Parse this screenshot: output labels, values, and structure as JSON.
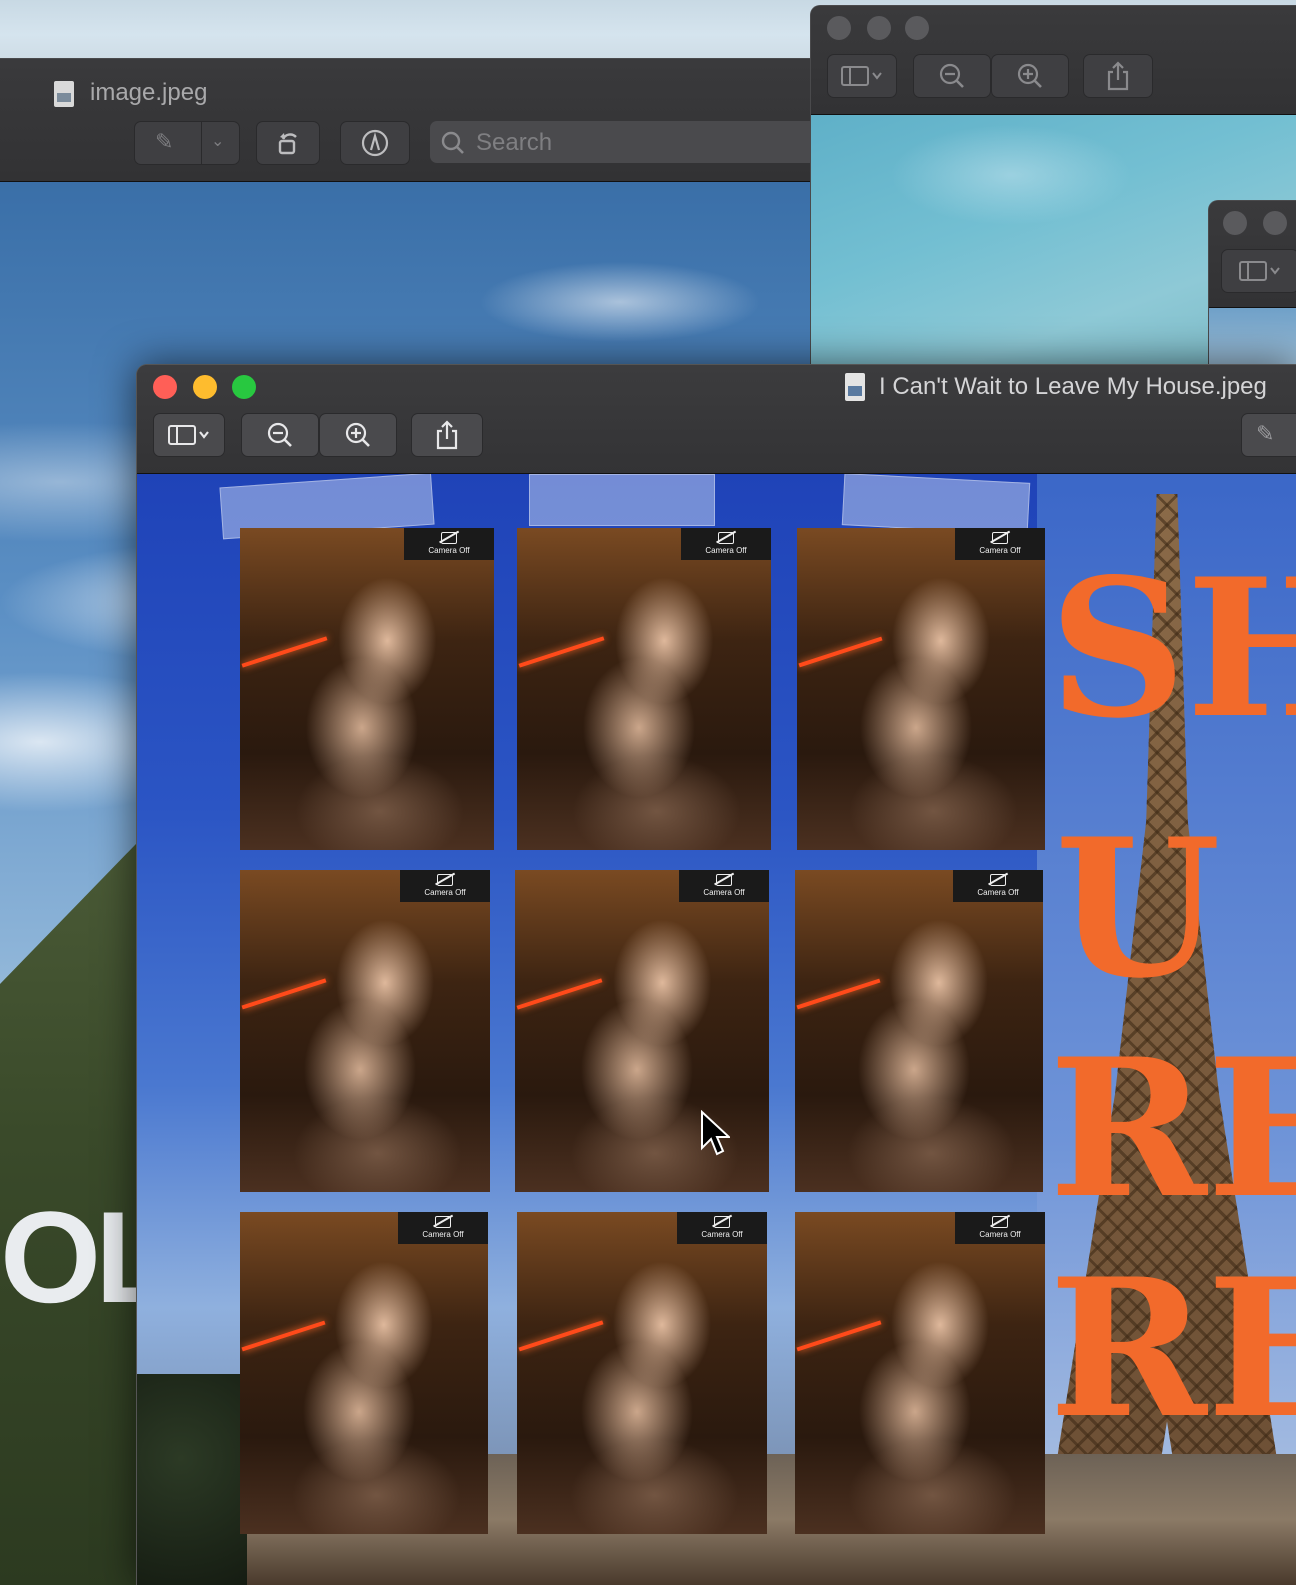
{
  "background_window": {
    "title": "image.jpeg",
    "search_placeholder": "Search",
    "sign_text": "OL"
  },
  "front_window": {
    "title": "I Can't Wait to Leave My House.jpeg",
    "toolbar": {
      "sidebar_icon": "sidebar-toggle-icon",
      "zoom_out_icon": "zoom-out-icon",
      "zoom_in_icon": "zoom-in-icon",
      "share_icon": "share-icon"
    },
    "collage": {
      "camera_off_label": "Camera Off",
      "big_letters": [
        "SH",
        "U",
        "RE",
        "RE"
      ]
    }
  },
  "colors": {
    "close": "#ff5f57",
    "minimize": "#febc2e",
    "maximize": "#28c840",
    "accent_orange": "#f26a2b"
  }
}
